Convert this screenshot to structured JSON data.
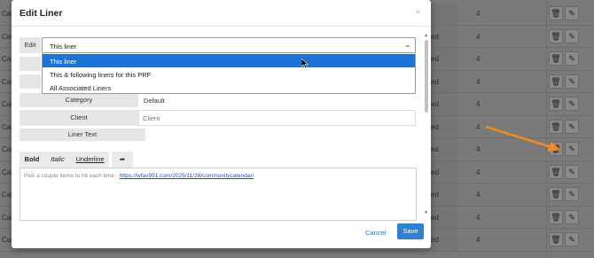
{
  "background": {
    "rows": [
      {
        "left": "Cale",
        "mid": "",
        "num": "4"
      },
      {
        "left": "Cale",
        "mid": "ed",
        "num": "4"
      },
      {
        "left": "Cale",
        "mid": "ed",
        "num": "4"
      },
      {
        "left": "Cale",
        "mid": "ed",
        "num": "4"
      },
      {
        "left": "Cale",
        "mid": "ed",
        "num": "4"
      },
      {
        "left": "Cale",
        "mid": "ed",
        "num": "4"
      },
      {
        "left": "Cale",
        "mid": "ed",
        "num": "4"
      },
      {
        "left": "Cale",
        "mid": "ed",
        "num": "4"
      },
      {
        "left": "Cale",
        "mid": "ed",
        "num": "4"
      },
      {
        "left": "Cale",
        "mid": "ed",
        "num": "4"
      },
      {
        "left": "Cale",
        "mid": "ed",
        "num": "4"
      }
    ],
    "delete_icon": "trash-icon",
    "edit_icon": "pencil-icon",
    "arrow_color": "#f08a24"
  },
  "modal": {
    "title": "Edit Liner",
    "close_label": "×",
    "edit_label": "Edit",
    "edit_select": {
      "value": "This liner",
      "options": [
        "This liner",
        "This & following liners for this PRF",
        "All Associated Liners"
      ]
    },
    "category_label": "Category",
    "category_value": "Default",
    "client_label": "Client",
    "client_placeholder": "Client",
    "liner_text_label": "Liner Text",
    "toolbar": {
      "bold": "Bold",
      "italic": "Italic",
      "underline": "Underline",
      "redo_icon": "redo-icon"
    },
    "editor": {
      "text": "Pick a couple items to hit each time - ",
      "link": "https://wfav951.com/2025/11/28/communitycalendar/"
    },
    "cancel_label": "Cancel",
    "save_label": "Save"
  },
  "colors": {
    "primary": "#2f80d1",
    "selected_option": "#1a73d8"
  }
}
